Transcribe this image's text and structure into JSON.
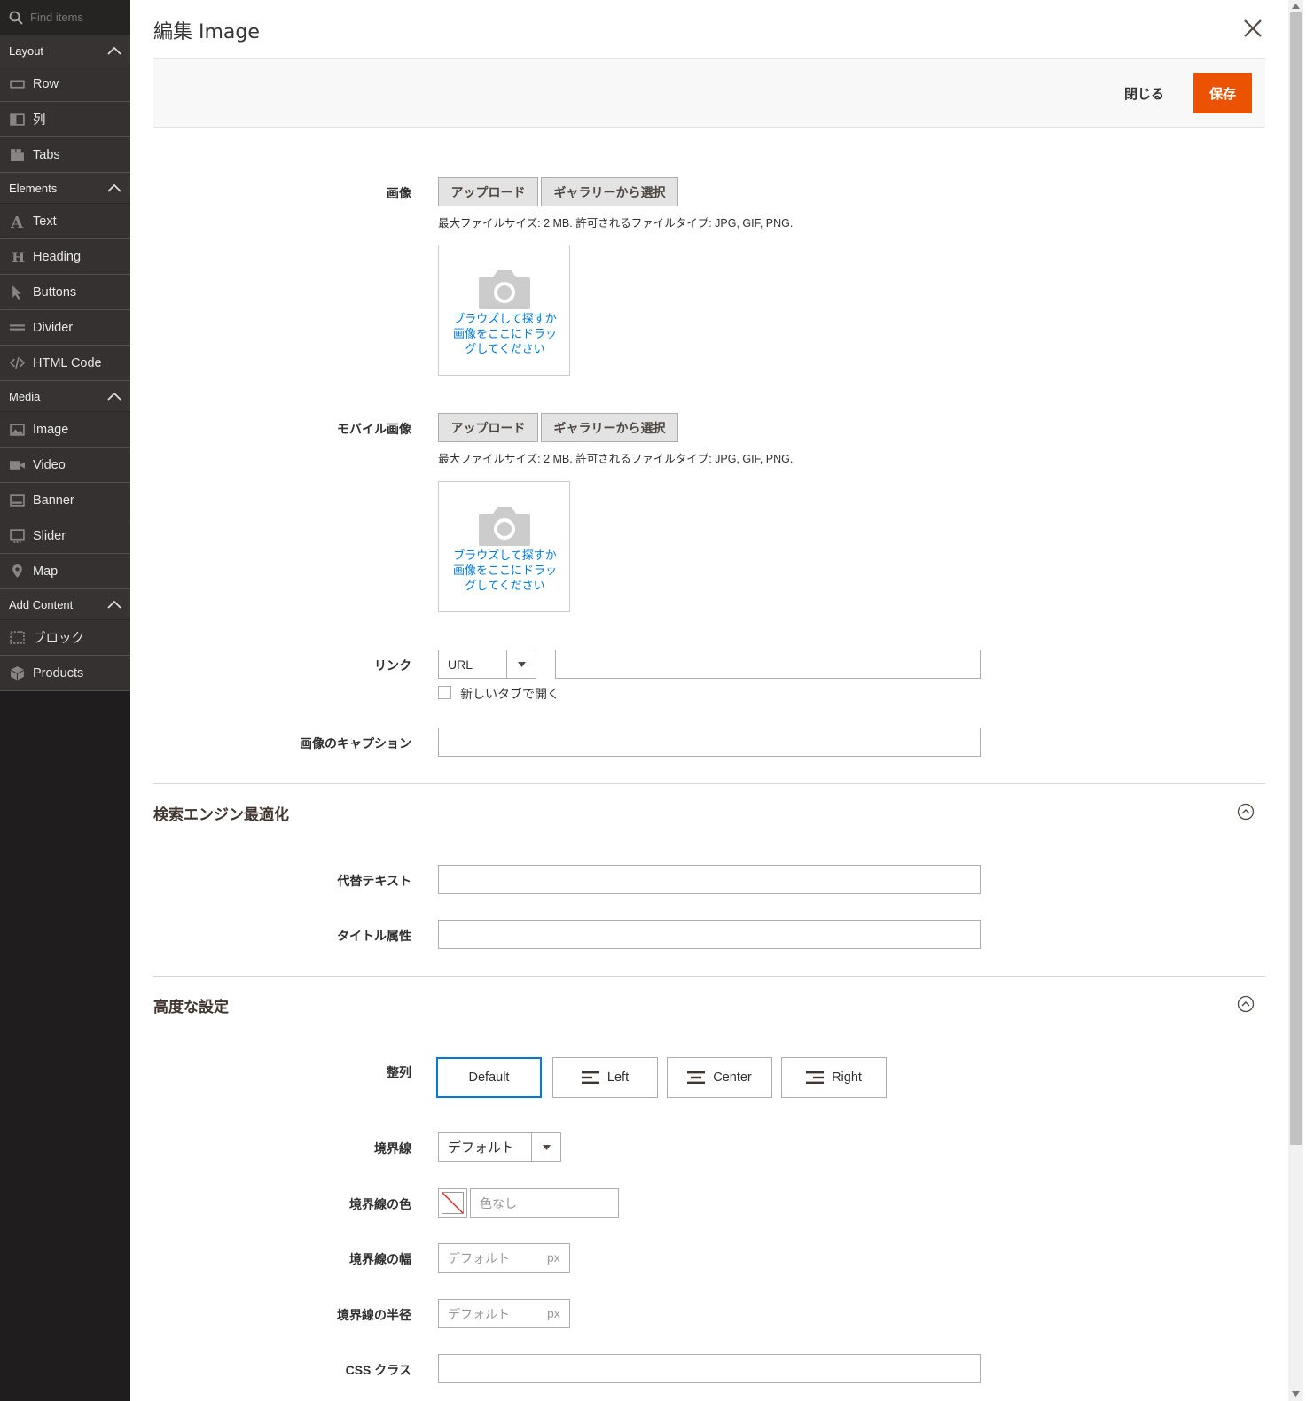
{
  "sidebar": {
    "search_placeholder": "Find items",
    "groups": [
      {
        "title": "Layout",
        "items": [
          "Row",
          "列",
          "Tabs"
        ]
      },
      {
        "title": "Elements",
        "items": [
          "Text",
          "Heading",
          "Buttons",
          "Divider",
          "HTML Code"
        ]
      },
      {
        "title": "Media",
        "items": [
          "Image",
          "Video",
          "Banner",
          "Slider",
          "Map"
        ]
      },
      {
        "title": "Add Content",
        "items": [
          "ブロック",
          "Products"
        ]
      }
    ]
  },
  "modal": {
    "title": "編集 Image",
    "close_label": "閉じる",
    "save_label": "保存"
  },
  "image": {
    "label": "画像",
    "upload": "アップロード",
    "gallery": "ギャラリーから選択",
    "note": "最大ファイルサイズ: 2 MB. 許可されるファイルタイプ: JPG, GIF, PNG.",
    "drop_text": "ブラウズして探すか画像をここにドラッグしてください"
  },
  "mobile_image": {
    "label": "モバイル画像",
    "upload": "アップロード",
    "gallery": "ギャラリーから選択",
    "note": "最大ファイルサイズ: 2 MB. 許可されるファイルタイプ: JPG, GIF, PNG.",
    "drop_text": "ブラウズして探すか画像をここにドラッグしてください"
  },
  "link": {
    "label": "リンク",
    "type": "URL",
    "value": "",
    "new_tab_label": "新しいタブで開く"
  },
  "caption": {
    "label": "画像のキャプション",
    "value": ""
  },
  "seo": {
    "title": "検索エンジン最適化",
    "alt_label": "代替テキスト",
    "title_attr_label": "タイトル属性"
  },
  "advanced": {
    "title": "高度な設定",
    "align_label": "整列",
    "align_options": [
      "Default",
      "Left",
      "Center",
      "Right"
    ],
    "border_label": "境界線",
    "border_value": "デフォルト",
    "border_color_label": "境界線の色",
    "border_color_placeholder": "色なし",
    "border_width_label": "境界線の幅",
    "border_width_placeholder": "デフォルト",
    "border_radius_label": "境界線の半径",
    "border_radius_placeholder": "デフォルト",
    "unit": "px",
    "css_label": "CSS クラス"
  },
  "colors": {
    "accent": "#eb5202",
    "focus": "#007bdb",
    "sidebar": "#1f1d1d"
  }
}
